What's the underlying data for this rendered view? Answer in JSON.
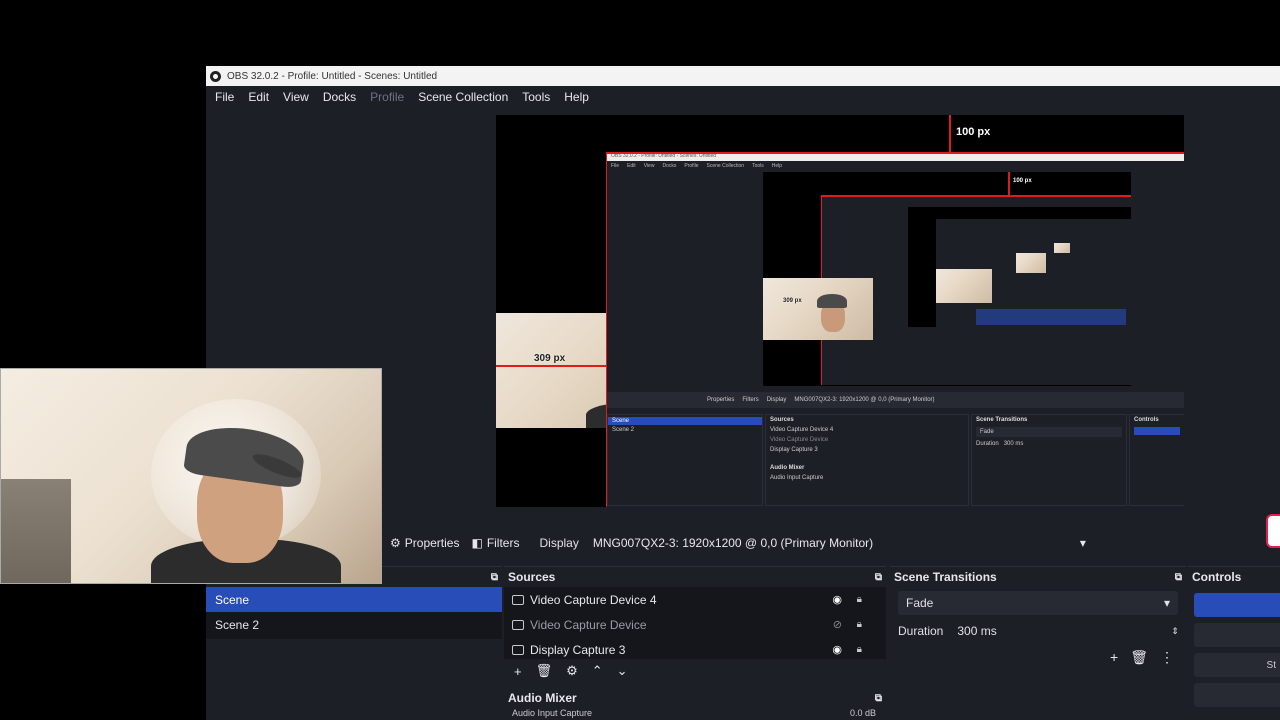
{
  "window": {
    "title": "OBS 32.0.2 - Profile: Untitled - Scenes: Untitled"
  },
  "menu": {
    "file": "File",
    "edit": "Edit",
    "view": "View",
    "docks": "Docks",
    "profile": "Profile",
    "scene_collection": "Scene Collection",
    "tools": "Tools",
    "help": "Help"
  },
  "preview": {
    "measure_top": "100 px",
    "measure_left": "309 px",
    "nested_measure_top": "100 px",
    "nested_measure_left": "309 px",
    "nested": {
      "title": "OBS 32.0.2 - Profile: Untitled - Scenes: Untitled",
      "menu": [
        "File",
        "Edit",
        "View",
        "Docks",
        "Profile",
        "Scene Collection",
        "Tools",
        "Help"
      ],
      "bar": {
        "properties": "Properties",
        "filters": "Filters",
        "display": "Display",
        "display_value": "MNG007QX2-3: 1920x1200 @ 0,0 (Primary Monitor)"
      },
      "scenes": [
        "Scene",
        "Scene 2"
      ],
      "sources_title": "Sources",
      "sources": [
        "Video Capture Device 4",
        "Video Capture Device",
        "Display Capture 3"
      ],
      "transitions_title": "Scene Transitions",
      "transition": "Fade",
      "duration_label": "Duration",
      "duration": "300 ms",
      "controls_title": "Controls",
      "audio_title": "Audio Mixer",
      "audio_source": "Audio Input Capture"
    }
  },
  "toolbar": {
    "properties": "Properties",
    "filters": "Filters",
    "display_label": "Display",
    "display_value": "MNG007QX2-3: 1920x1200 @ 0,0 (Primary Monitor)"
  },
  "scenes": {
    "items": [
      "Scene",
      "Scene 2"
    ]
  },
  "sources": {
    "title": "Sources",
    "items": [
      {
        "name": "Video Capture Device 4",
        "visible": true
      },
      {
        "name": "Video Capture Device",
        "visible": false
      },
      {
        "name": "Display Capture 3",
        "visible": true
      }
    ]
  },
  "transitions": {
    "title": "Scene Transitions",
    "selected": "Fade",
    "duration_label": "Duration",
    "duration_value": "300 ms"
  },
  "controls": {
    "title": "Controls",
    "partial_label": "St"
  },
  "audio_mixer": {
    "title": "Audio Mixer",
    "source": "Audio Input Capture",
    "level": "0.0 dB"
  },
  "colors": {
    "accent": "#284cb8",
    "panel": "#1d1f26",
    "guide": "#e01b1b"
  }
}
